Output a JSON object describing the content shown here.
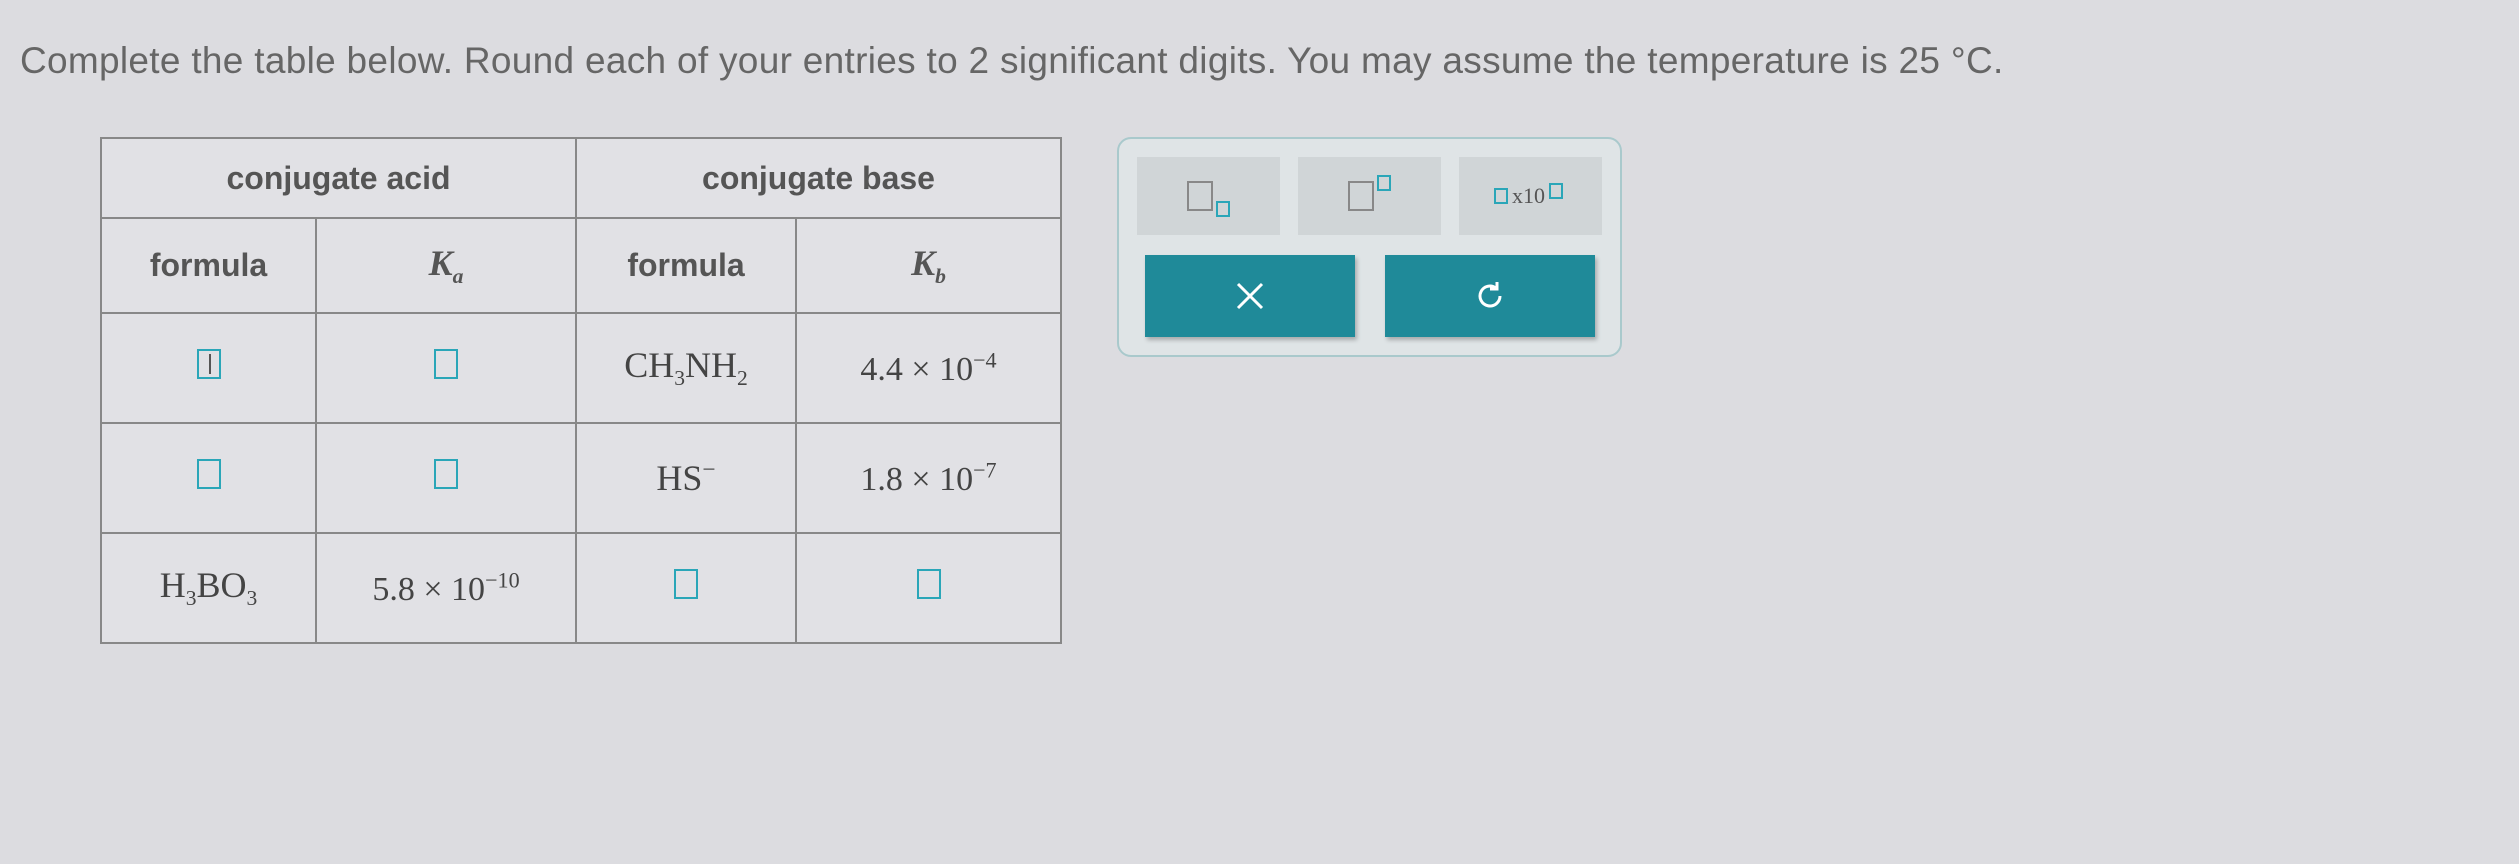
{
  "instruction": {
    "prefix": "Complete the table below. Round each of your entries to ",
    "sig": "2",
    "mid": " significant digits. You may assume the temperature is ",
    "temp": "25",
    "unit": " °C."
  },
  "table": {
    "header_acid": "conjugate acid",
    "header_base": "conjugate base",
    "sub_formula": "formula",
    "Ka_symbol": "K",
    "Ka_sub": "a",
    "Kb_symbol": "K",
    "Kb_sub": "b",
    "rows": [
      {
        "base_formula_html": "CH<sub>3</sub>NH<sub>2</sub>",
        "kb_mantissa": "4.4",
        "kb_times": " × 10",
        "kb_exp": "−4"
      },
      {
        "base_formula_html": "HS<sup>−</sup>",
        "kb_mantissa": "1.8",
        "kb_times": " × 10",
        "kb_exp": "−7"
      },
      {
        "acid_formula_html": "H<sub>3</sub>BO<sub>3</sub>",
        "ka_mantissa": "5.8",
        "ka_times": " × 10",
        "ka_exp": "−10"
      }
    ]
  },
  "toolbox": {
    "sci_label": "x10"
  }
}
